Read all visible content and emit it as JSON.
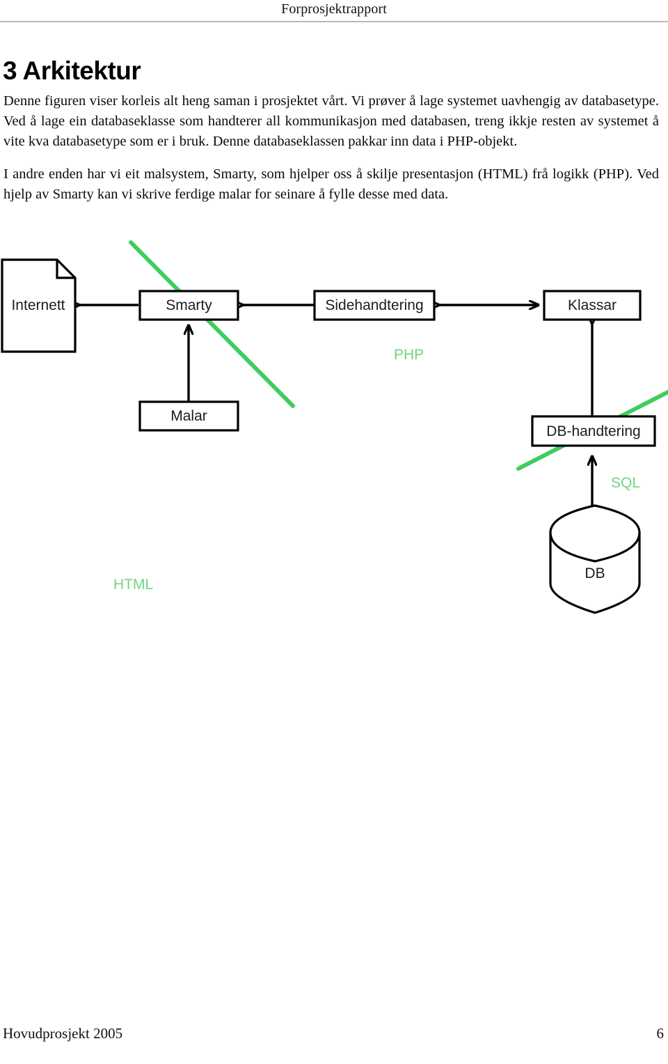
{
  "header": {
    "title": "Forprosjektrapport"
  },
  "heading": {
    "number_and_title": "3 Arkitektur"
  },
  "body": {
    "paragraph_1": "Denne figuren viser korleis alt heng saman i prosjektet vårt. Vi prøver å lage systemet uavhengig av databasetype. Ved å lage ein databaseklasse som handterer all kommunikasjon med databasen, treng ikkje resten av systemet å vite kva databasetype som er i bruk. Denne databaseklassen pakkar inn data i PHP-objekt.",
    "paragraph_2": "I andre enden har vi eit malsystem, Smarty, som hjelper oss å skilje presentasjon (HTML) frå logikk (PHP). Ved hjelp av Smarty kan vi skrive ferdige malar for seinare å fylle desse med data."
  },
  "diagram": {
    "nodes": {
      "internett": "Internett",
      "smarty": "Smarty",
      "malar": "Malar",
      "sidehandtering": "Sidehandtering",
      "klassar": "Klassar",
      "db_handtering": "DB-handtering",
      "db": "DB"
    },
    "protocol_labels": {
      "html": "HTML",
      "php": "PHP",
      "sql": "SQL"
    },
    "colors": {
      "stroke": "#000000",
      "fill": "#ffffff",
      "accent_green": "#3fcd5c",
      "label_green": "#6fd481"
    }
  },
  "footer": {
    "left": "Hovudprosjekt 2005",
    "right": "6"
  }
}
